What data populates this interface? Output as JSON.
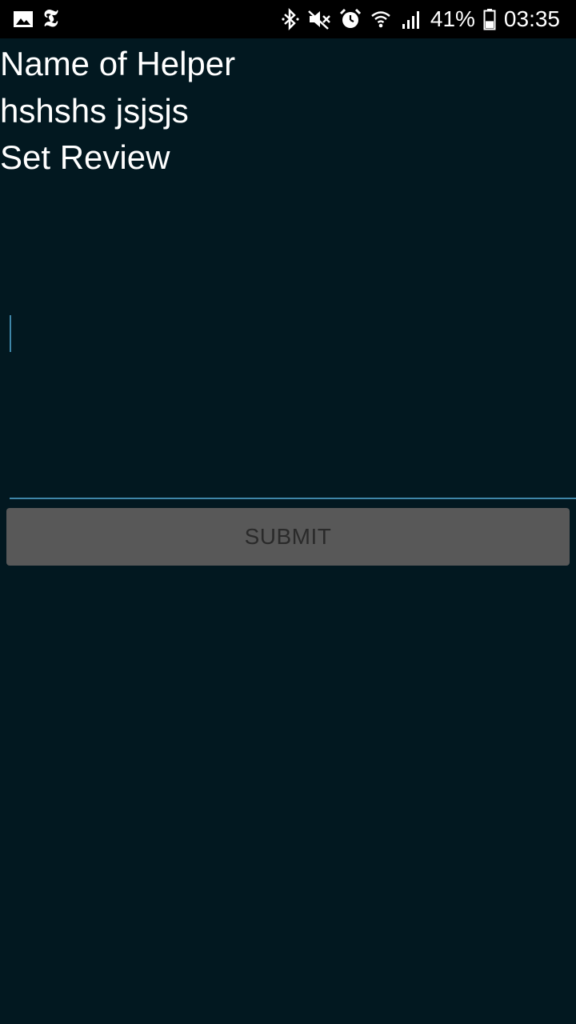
{
  "status_bar": {
    "left_icons": [
      "gallery-icon",
      "nyt-icon"
    ],
    "nyt_glyph": "𝕿",
    "right_icons": [
      "bluetooth-icon",
      "mute-icon",
      "alarm-icon",
      "wifi-icon",
      "signal-icon",
      "battery-icon"
    ],
    "battery_percent": "41%",
    "battery_level": 0.41,
    "time": "03:35"
  },
  "form": {
    "name_label": "Name of Helper",
    "name_value": "hshshs jsjsjs",
    "review_label": "Set Review",
    "review_value": "",
    "submit_label": "SUBMIT"
  },
  "colors": {
    "background": "#021820",
    "status_bar": "#000000",
    "accent": "#3f86a8",
    "button_bg": "#585858",
    "button_text": "#2a2a2a"
  }
}
